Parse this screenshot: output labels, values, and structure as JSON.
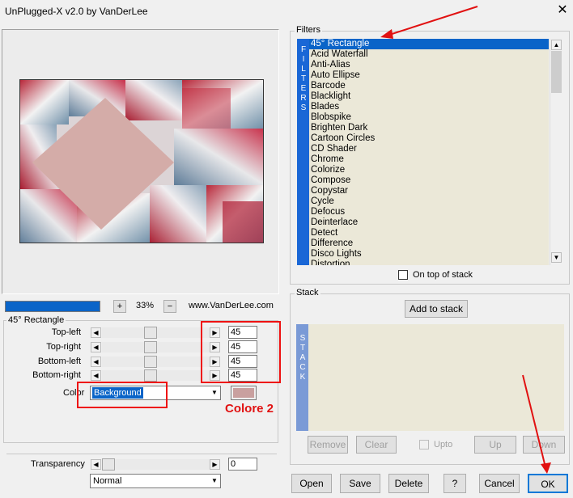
{
  "window": {
    "title": "UnPlugged-X v2.0 by VanDerLee",
    "close_glyph": "✕"
  },
  "preview": {
    "zoom": "33%",
    "plus": "+",
    "minus": "−",
    "site": "www.VanDerLee.com"
  },
  "params": {
    "group_title": "45° Rectangle",
    "sliders": [
      {
        "label": "Top-left",
        "value": "45"
      },
      {
        "label": "Top-right",
        "value": "45"
      },
      {
        "label": "Bottom-left",
        "value": "45"
      },
      {
        "label": "Bottom-right",
        "value": "45"
      }
    ],
    "color_label": "Color",
    "color_value": "Background",
    "swatch_color": "#c9a09f",
    "annotation": "Colore 2"
  },
  "transparency": {
    "label": "Transparency",
    "value": "0",
    "blend_mode": "Normal"
  },
  "filters": {
    "group_title": "Filters",
    "side_label": "FILTERS",
    "items": [
      "45° Rectangle",
      "Acid Waterfall",
      "Anti-Alias",
      "Auto Ellipse",
      "Barcode",
      "Blacklight",
      "Blades",
      "Blobspike",
      "Brighten Dark",
      "Cartoon Circles",
      "CD Shader",
      "Chrome",
      "Colorize",
      "Compose",
      "Copystar",
      "Cycle",
      "Defocus",
      "Deinterlace",
      "Detect",
      "Difference",
      "Disco Lights",
      "Distortion"
    ],
    "selected_index": 0,
    "on_top_label": "On top of stack"
  },
  "stack": {
    "group_title": "Stack",
    "side_label": "STACK",
    "add_label": "Add to stack",
    "remove_label": "Remove",
    "clear_label": "Clear",
    "upto_label": "Upto",
    "up_label": "Up",
    "down_label": "Down"
  },
  "bottom": {
    "open": "Open",
    "save": "Save",
    "delete": "Delete",
    "help": "?",
    "cancel": "Cancel",
    "ok": "OK"
  },
  "colors": {
    "accent": "#0a64c8",
    "annotation_red": "#e11111",
    "list_bg": "#ebe8d8"
  }
}
